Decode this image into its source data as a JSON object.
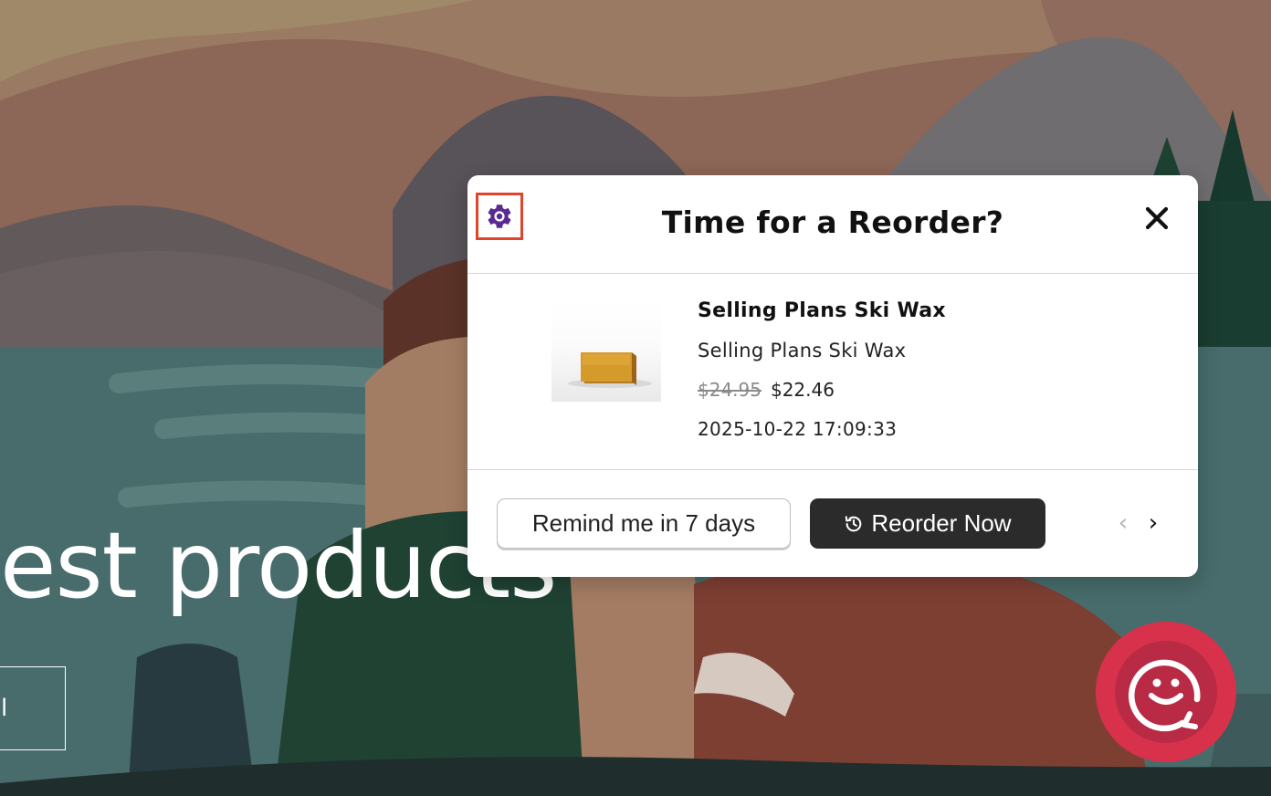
{
  "hero": {
    "heading": "est products",
    "button_label": "l"
  },
  "modal": {
    "title": "Time for a Reorder?",
    "settings_icon": "gear-icon",
    "close_icon": "close-icon",
    "product": {
      "title": "Selling Plans Ski Wax",
      "variant": "Selling Plans Ski Wax",
      "compare_price": "$24.95",
      "price": "$22.46",
      "ordered_at": "2025-10-22 17:09:33"
    },
    "actions": {
      "remind_label": "Remind me in 7 days",
      "reorder_label": "Reorder Now",
      "reorder_icon": "history-icon",
      "prev_symbol": "‹",
      "next_symbol": "›"
    }
  },
  "chat_widget": {
    "icon": "smiley-chat-icon"
  },
  "colors": {
    "accent_purple": "#5b2a91",
    "focus_outline": "#e0452c",
    "reorder_button": "#2b2b2b",
    "chat_widget": "#d8314c"
  }
}
